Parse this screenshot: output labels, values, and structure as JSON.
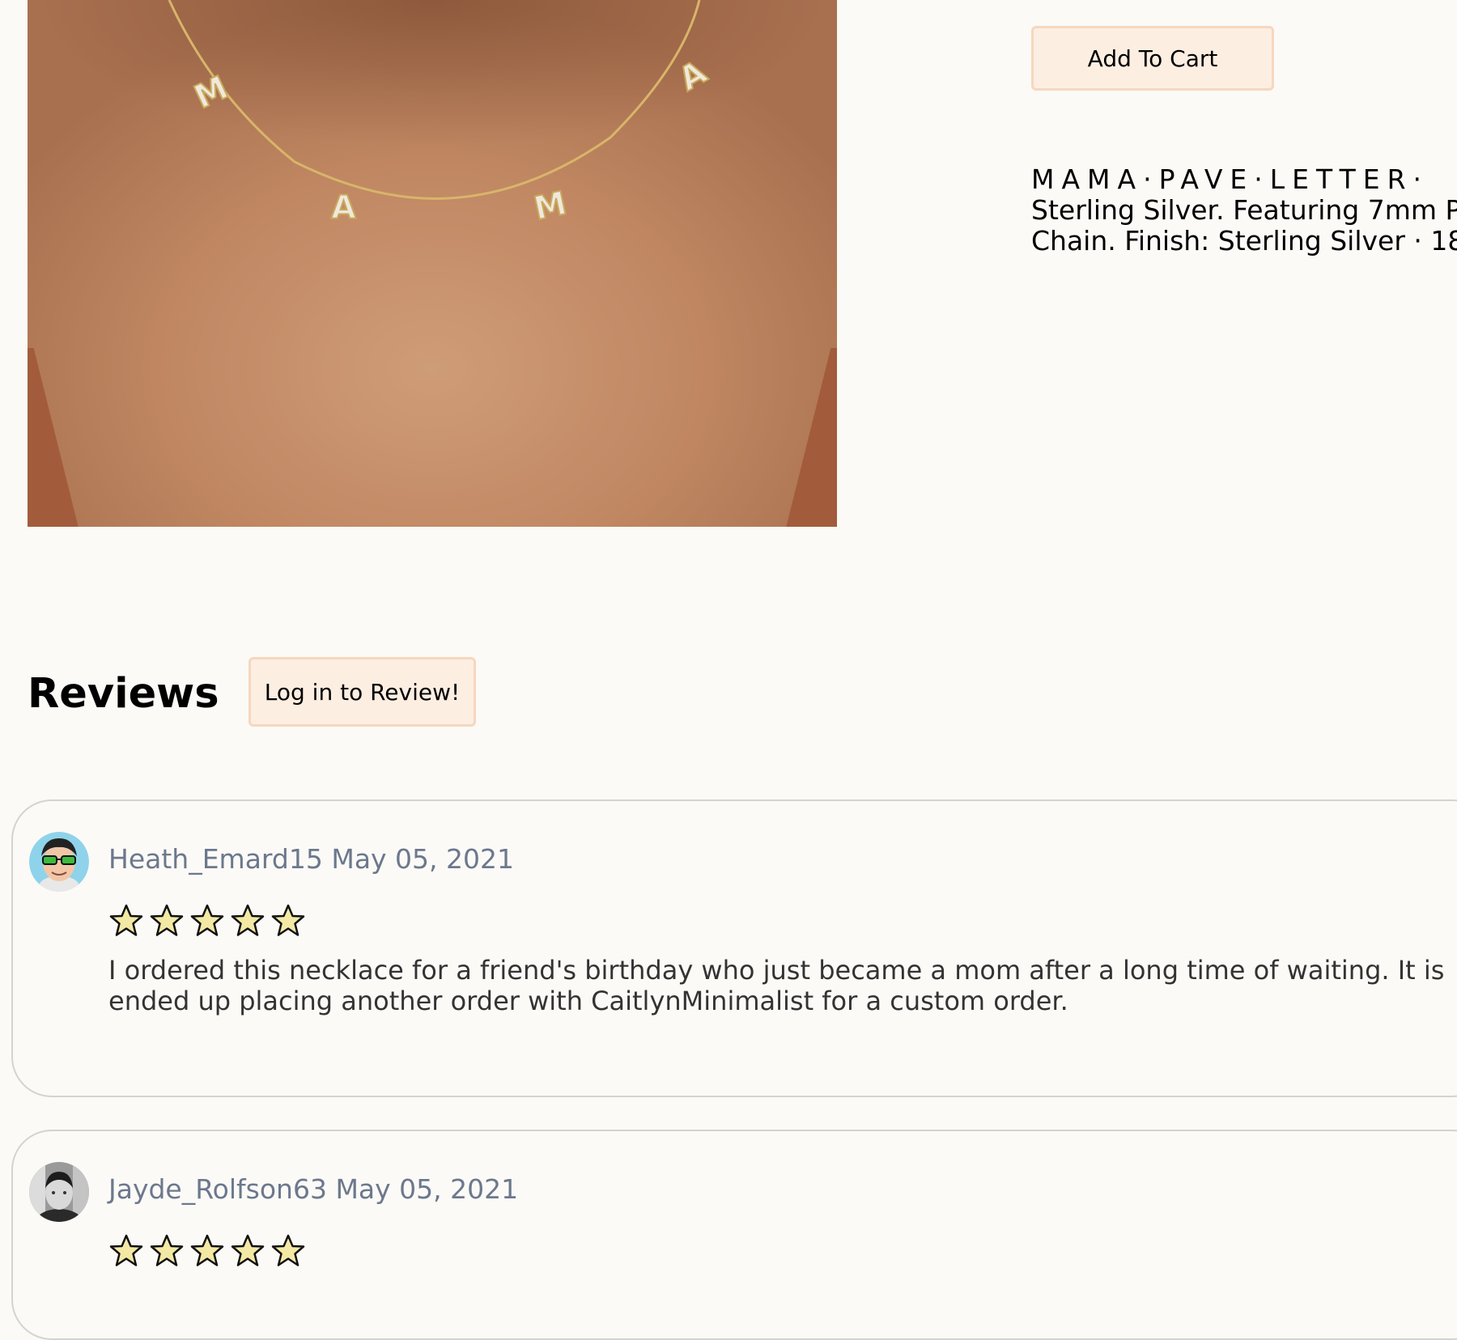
{
  "product": {
    "image_alt": "MAMA pave letter necklace worn on neck",
    "add_to_cart_label": "Add To Cart",
    "title": "MAMA·PAVE·LETTER·",
    "description_line1": "Sterling Silver. Featuring 7mm P",
    "description_line2": "Chain. Finish: Sterling Silver · 18"
  },
  "reviews": {
    "heading": "Reviews",
    "login_button": "Log in to Review!",
    "items": [
      {
        "username": "Heath_Emard15",
        "date": "May 05, 2021",
        "rating": 5,
        "body_line1": "I ordered this necklace for a friend's birthday who just became a mom after a long time of waiting. It is",
        "body_line2": "ended up placing another order with CaitlynMinimalist for a custom order."
      },
      {
        "username": "Jayde_Rolfson63",
        "date": "May 05, 2021",
        "rating": 5
      }
    ]
  },
  "colors": {
    "background": "#fbfaf7",
    "button_fill": "#fdeee2",
    "button_border": "#f7d7bd",
    "meta_text": "#6c788c",
    "star_fill": "#f3e9a4"
  },
  "icons": {
    "star": "star-icon"
  }
}
